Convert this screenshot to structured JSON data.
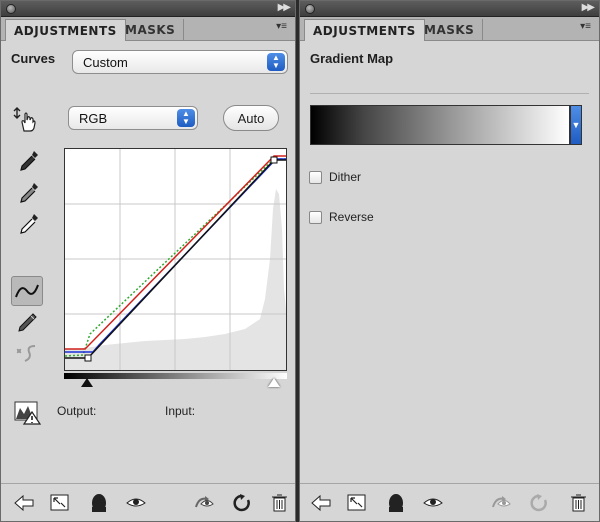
{
  "left": {
    "tabs": {
      "active": "ADJUSTMENTS",
      "inactive": "MASKS"
    },
    "heading": "Curves",
    "preset": "Custom",
    "channel": "RGB",
    "auto_label": "Auto",
    "output_label": "Output:",
    "input_label": "Input:"
  },
  "right": {
    "tabs": {
      "active": "ADJUSTMENTS",
      "inactive": "MASKS"
    },
    "heading": "Gradient Map",
    "dither_label": "Dither",
    "dither_checked": false,
    "reverse_label": "Reverse",
    "reverse_checked": false
  },
  "curve_colors": {
    "rgb": "#111111",
    "red": "#d2211b",
    "green": "#2fa82f",
    "blue": "#1a2fd6"
  },
  "icons": {
    "left_tools": [
      "on-image-adjust-icon",
      "black-point-eyedropper-icon",
      "gray-point-eyedropper-icon",
      "white-point-eyedropper-icon",
      "curve-point-tool-icon",
      "pencil-draw-icon",
      "smooth-curve-icon"
    ],
    "footer": [
      "back-arrow-icon",
      "expand-view-icon",
      "clip-to-layer-icon",
      "visibility-eye-icon",
      "view-previous-icon",
      "reset-icon",
      "trash-icon"
    ]
  }
}
